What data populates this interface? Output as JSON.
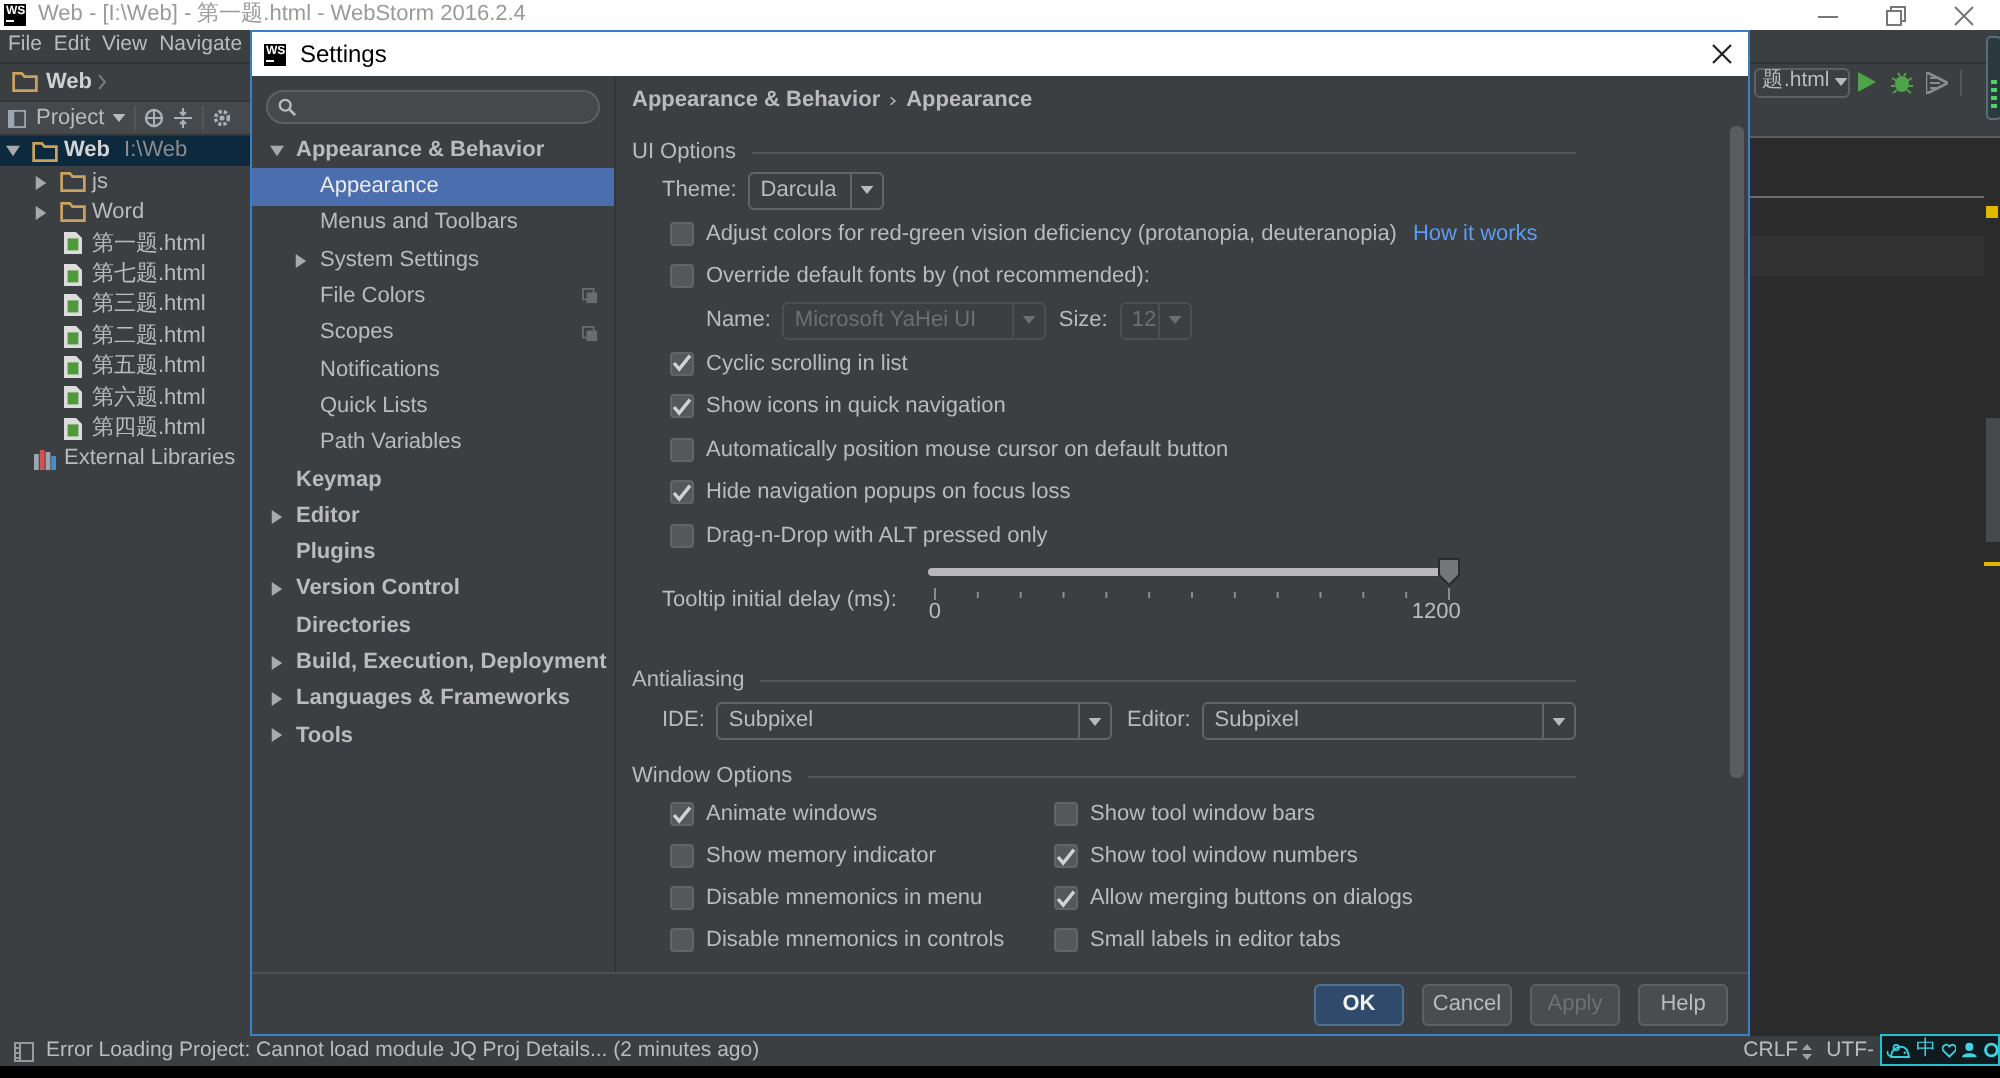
{
  "ide": {
    "logo": "WS",
    "title": "Web - [I:\\Web] - 第一题.html - WebStorm 2016.2.4",
    "menu": [
      {
        "label": "File"
      },
      {
        "label": "Edit"
      },
      {
        "label": "View"
      },
      {
        "label": "Navigate"
      }
    ],
    "nav_bar": {
      "crumb": "Web",
      "run_config": "题.html"
    },
    "project_view": {
      "title": "Project"
    },
    "tree": [
      {
        "label": "Web",
        "path": "I:\\Web",
        "kind": "folder",
        "expanded": true,
        "selected": true,
        "children": [
          {
            "label": "js",
            "kind": "folder",
            "expanded": false,
            "selected": false
          },
          {
            "label": "Word",
            "kind": "folder",
            "expanded": false,
            "selected": false
          },
          {
            "label": "第一题.html",
            "kind": "html",
            "selected": false
          },
          {
            "label": "第七题.html",
            "kind": "html",
            "selected": false
          },
          {
            "label": "第三题.html",
            "kind": "html",
            "selected": false
          },
          {
            "label": "第二题.html",
            "kind": "html",
            "selected": false
          },
          {
            "label": "第五题.html",
            "kind": "html",
            "selected": false
          },
          {
            "label": "第六题.html",
            "kind": "html",
            "selected": false
          },
          {
            "label": "第四题.html",
            "kind": "html",
            "selected": false
          }
        ]
      },
      {
        "label": "External Libraries",
        "kind": "library",
        "selected": false
      }
    ],
    "status_bar": {
      "message": "Error Loading Project: Cannot load module JQ Proj Details... (2 minutes ago)",
      "line_separator": "CRLF",
      "encoding": "UTF-"
    },
    "ime_bar": {
      "label": "中"
    }
  },
  "dialog": {
    "logo": "WS",
    "title": "Settings",
    "nav": [
      {
        "label": "Appearance & Behavior",
        "expanded": true,
        "selected": false,
        "children": [
          {
            "label": "Appearance",
            "selected": true,
            "project_scoped": false
          },
          {
            "label": "Menus and Toolbars",
            "selected": false,
            "project_scoped": false
          },
          {
            "label": "System Settings",
            "expanded": false,
            "selected": false,
            "project_scoped": false
          },
          {
            "label": "File Colors",
            "selected": false,
            "project_scoped": true
          },
          {
            "label": "Scopes",
            "selected": false,
            "project_scoped": true
          },
          {
            "label": "Notifications",
            "selected": false,
            "project_scoped": false
          },
          {
            "label": "Quick Lists",
            "selected": false,
            "project_scoped": false
          },
          {
            "label": "Path Variables",
            "selected": false,
            "project_scoped": false
          }
        ]
      },
      {
        "label": "Keymap",
        "selected": false
      },
      {
        "label": "Editor",
        "expanded": false,
        "selected": false
      },
      {
        "label": "Plugins",
        "selected": false
      },
      {
        "label": "Version Control",
        "expanded": false,
        "selected": false
      },
      {
        "label": "Directories",
        "selected": false
      },
      {
        "label": "Build, Execution, Deployment",
        "expanded": false,
        "selected": false
      },
      {
        "label": "Languages & Frameworks",
        "expanded": false,
        "selected": false
      },
      {
        "label": "Tools",
        "expanded": false,
        "selected": false
      }
    ],
    "breadcrumb": [
      {
        "label": "Appearance & Behavior"
      },
      {
        "label": "Appearance"
      }
    ],
    "sections": [
      {
        "title": "UI Options",
        "kind": "stack",
        "items": [
          {
            "kind": "combo",
            "label": "Theme:",
            "value": "Darcula"
          },
          {
            "kind": "checkbox",
            "label": "Adjust colors for red-green vision deficiency (protanopia, deuteranopia)",
            "checked": false,
            "link": "How it works"
          },
          {
            "kind": "checkbox",
            "label": "Override default fonts by (not recommended):",
            "checked": false
          },
          {
            "kind": "font_fields",
            "disabled": true,
            "fields": [
              {
                "label": "Name:",
                "value": "Microsoft YaHei UI"
              },
              {
                "label": "Size:",
                "value": "12"
              }
            ]
          },
          {
            "kind": "checkbox",
            "label": "Cyclic scrolling in list",
            "checked": true
          },
          {
            "kind": "checkbox",
            "label": "Show icons in quick navigation",
            "checked": true
          },
          {
            "kind": "checkbox",
            "label": "Automatically position mouse cursor on default button",
            "checked": false
          },
          {
            "kind": "checkbox",
            "label": "Hide navigation popups on focus loss",
            "checked": true
          },
          {
            "kind": "checkbox",
            "label": "Drag-n-Drop with ALT pressed only",
            "checked": false
          },
          {
            "kind": "slider",
            "label": "Tooltip initial delay (ms):",
            "level": 1,
            "min_label": "0",
            "max_label": "1200"
          }
        ]
      },
      {
        "title": "Antialiasing",
        "kind": "row",
        "items": [
          {
            "kind": "combo",
            "label": "IDE:",
            "value": "Subpixel"
          },
          {
            "kind": "combo",
            "label": "Editor:",
            "value": "Subpixel"
          }
        ]
      },
      {
        "title": "Window Options",
        "kind": "grid",
        "items": [
          {
            "kind": "checkbox",
            "label": "Animate windows",
            "checked": true
          },
          {
            "kind": "checkbox",
            "label": "Show tool window bars",
            "checked": false
          },
          {
            "kind": "checkbox",
            "label": "Show memory indicator",
            "checked": false
          },
          {
            "kind": "checkbox",
            "label": "Show tool window numbers",
            "checked": true
          },
          {
            "kind": "checkbox",
            "label": "Disable mnemonics in menu",
            "checked": false
          },
          {
            "kind": "checkbox",
            "label": "Allow merging buttons on dialogs",
            "checked": true
          },
          {
            "kind": "checkbox",
            "label": "Disable mnemonics in controls",
            "checked": false
          },
          {
            "kind": "checkbox",
            "label": "Small labels in editor tabs",
            "checked": false
          }
        ]
      }
    ],
    "buttons": [
      {
        "label": "OK",
        "default": true,
        "disabled": false
      },
      {
        "label": "Cancel",
        "default": false,
        "disabled": false
      },
      {
        "label": "Apply",
        "default": false,
        "disabled": true
      },
      {
        "label": "Help",
        "default": false,
        "disabled": false
      }
    ]
  }
}
